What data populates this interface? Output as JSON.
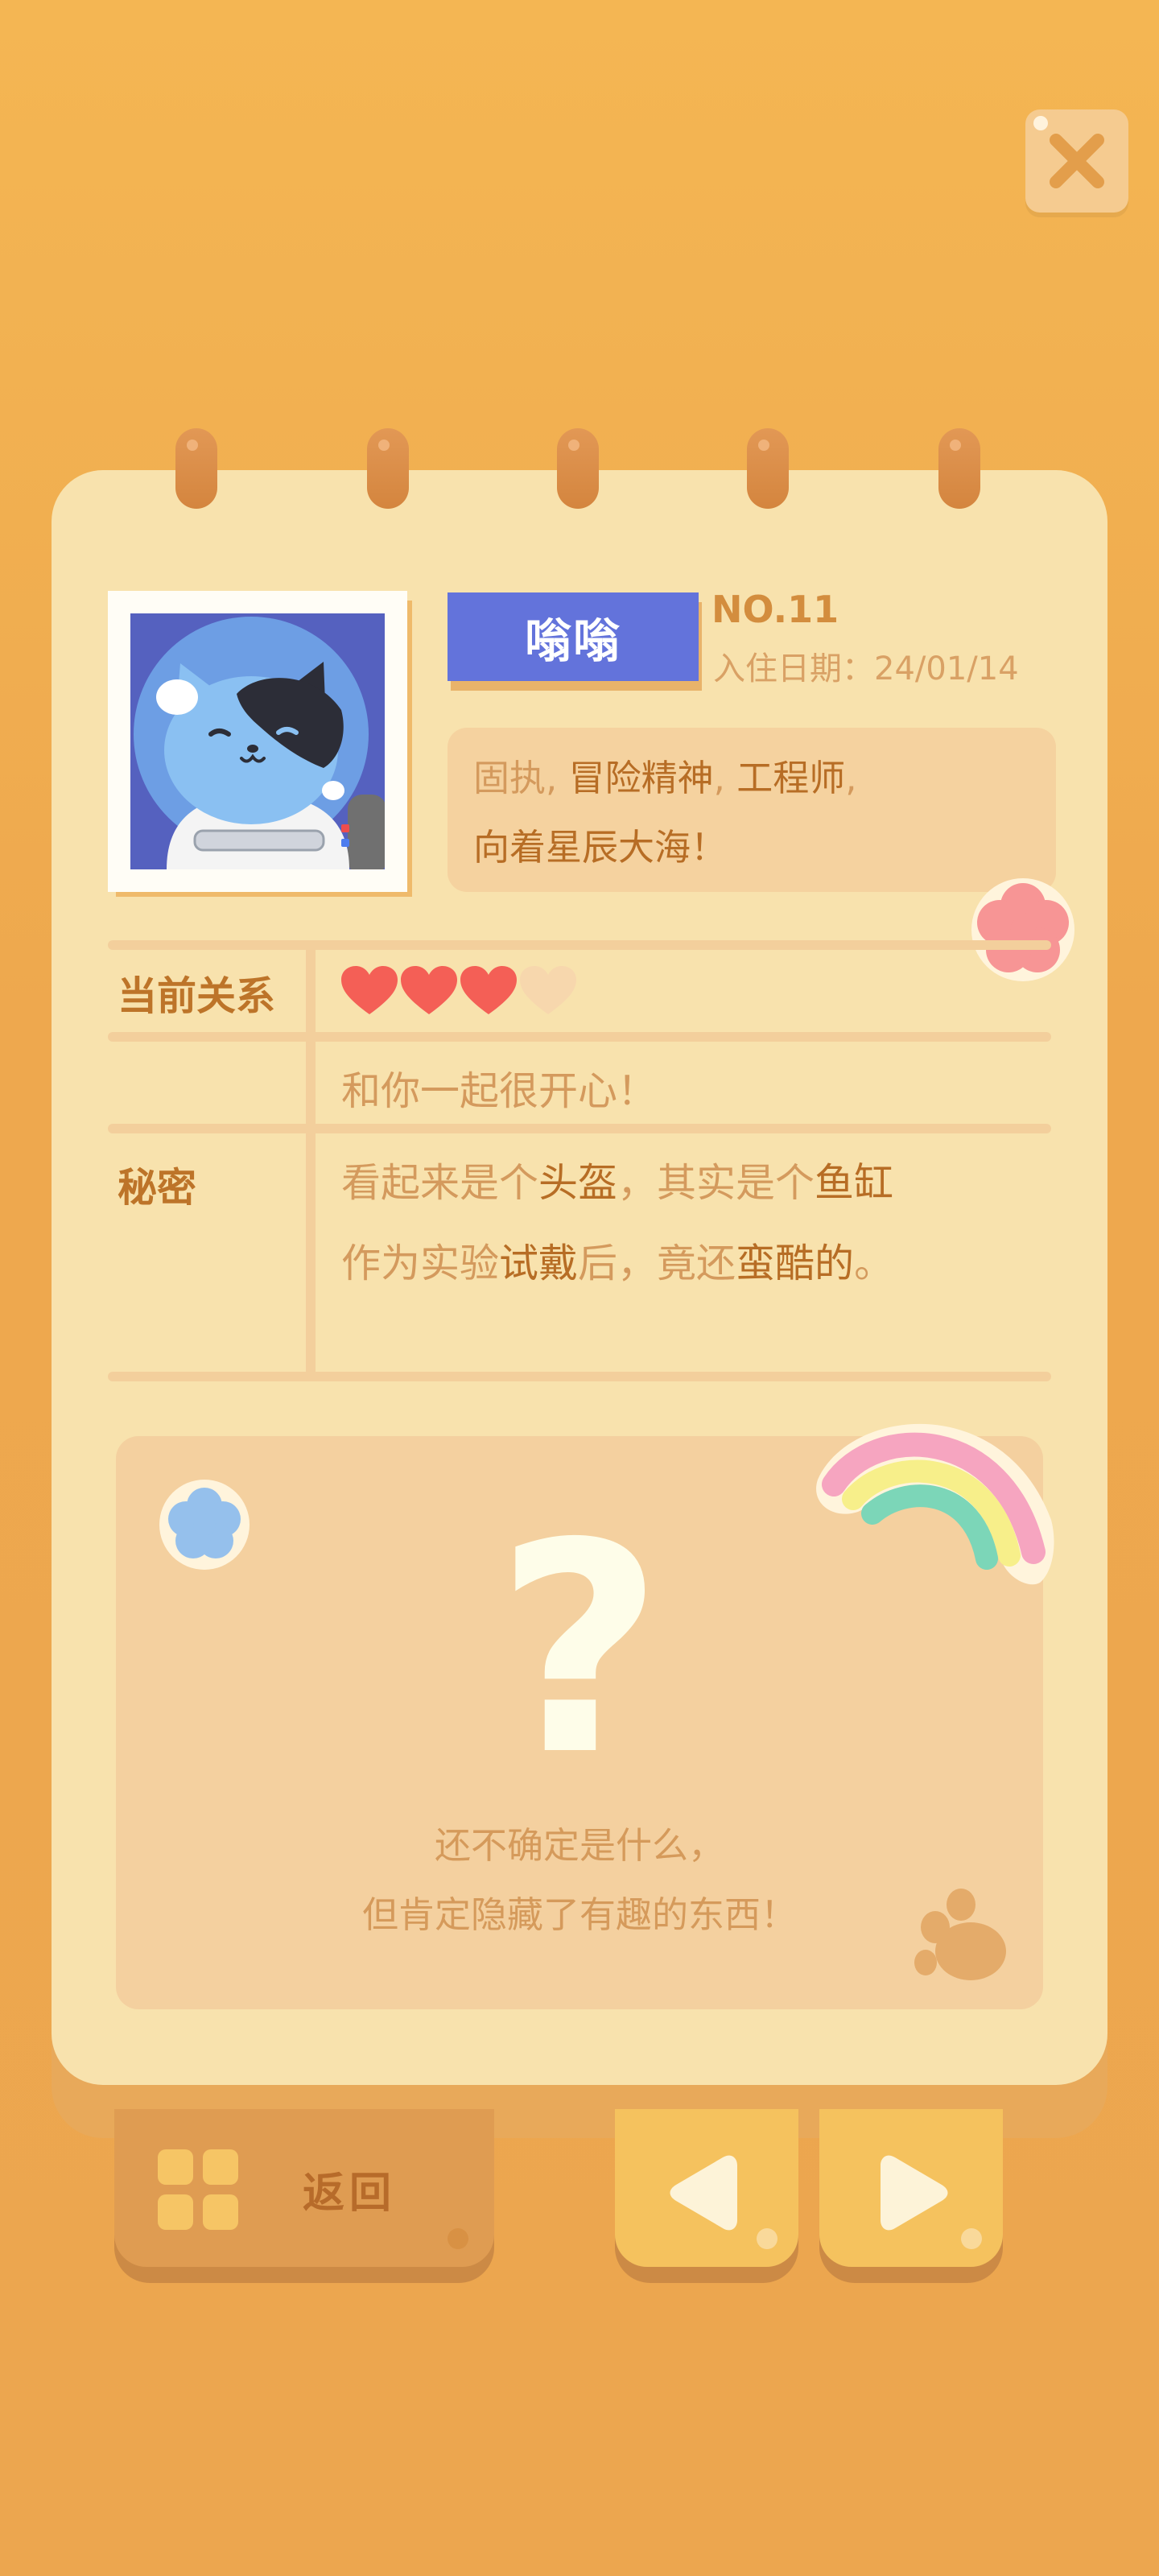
{
  "close_button": {
    "icon": "close-icon"
  },
  "profile": {
    "name": "嗡嗡",
    "number": "NO.11",
    "move_in_date": "入住日期：24/01/14",
    "traits_line1_plain": "固执,",
    "traits_line1_hl1": "冒险精神",
    "traits_line1_sep": ",",
    "traits_line1_hl2": "工程师",
    "traits_line1_end": ",",
    "traits_line2": "向着星辰大海！"
  },
  "relationship": {
    "label": "当前关系",
    "hearts_filled": 3,
    "hearts_total": 4,
    "message": "和你一起很开心！"
  },
  "secret": {
    "label": "秘密",
    "line1": [
      "看起来是个",
      "头盔",
      "，其实是个",
      "鱼缸"
    ],
    "line2": [
      "作为实验",
      "试戴",
      "后，竟还",
      "蛮酷的",
      "。"
    ]
  },
  "mystery": {
    "symbol": "?",
    "line1": "还不确定是什么，",
    "line2": "但肯定隐藏了有趣的东西！"
  },
  "bottom_bar": {
    "back_label": "返回",
    "prev_icon": "triangle-left-icon",
    "next_icon": "triangle-right-icon"
  },
  "colors": {
    "background": "#f0ac52",
    "card": "#f8e2ad",
    "name_tag": "#6373db",
    "heart": "#f45f56",
    "heart_empty": "#f7d7ad",
    "nav_button": "#f5c25e",
    "back_button": "#df9c52"
  }
}
